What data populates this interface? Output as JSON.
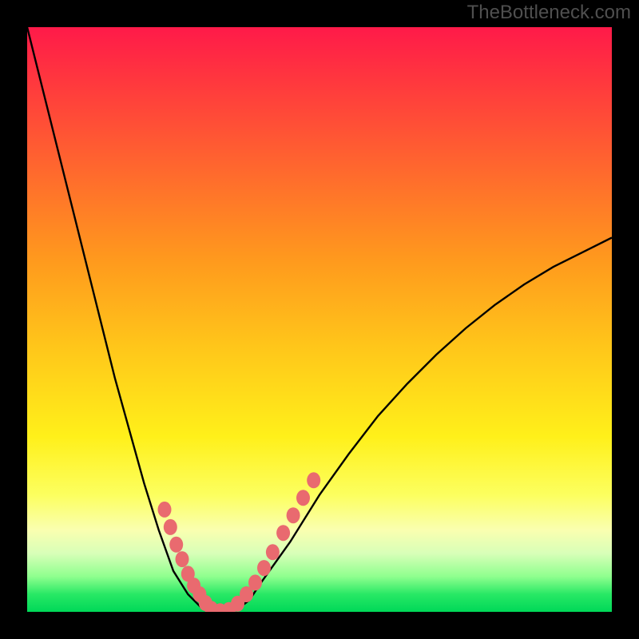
{
  "watermark": "TheBottleneck.com",
  "colors": {
    "curve": "#000000",
    "dots": "#e96a6f",
    "frame_bg": "#000000"
  },
  "chart_data": {
    "type": "line",
    "title": "",
    "xlabel": "",
    "ylabel": "",
    "xlim": [
      0,
      1
    ],
    "ylim": [
      0,
      1
    ],
    "grid": false,
    "legend": false,
    "x": [
      0.0,
      0.05,
      0.1,
      0.15,
      0.2,
      0.225,
      0.25,
      0.275,
      0.3,
      0.32,
      0.34,
      0.36,
      0.38,
      0.4,
      0.45,
      0.5,
      0.55,
      0.6,
      0.65,
      0.7,
      0.75,
      0.8,
      0.85,
      0.9,
      0.95,
      1.0
    ],
    "values": [
      1.0,
      0.8,
      0.6,
      0.4,
      0.22,
      0.14,
      0.07,
      0.03,
      0.005,
      0.0,
      0.0,
      0.005,
      0.02,
      0.05,
      0.12,
      0.2,
      0.27,
      0.335,
      0.39,
      0.44,
      0.485,
      0.525,
      0.56,
      0.59,
      0.615,
      0.64
    ],
    "minimum_x": 0.33,
    "dots_left": [
      {
        "x": 0.235,
        "y": 0.175
      },
      {
        "x": 0.245,
        "y": 0.145
      },
      {
        "x": 0.255,
        "y": 0.115
      },
      {
        "x": 0.265,
        "y": 0.09
      },
      {
        "x": 0.275,
        "y": 0.065
      },
      {
        "x": 0.285,
        "y": 0.045
      },
      {
        "x": 0.295,
        "y": 0.03
      },
      {
        "x": 0.305,
        "y": 0.015
      }
    ],
    "dots_bottom": [
      {
        "x": 0.315,
        "y": 0.005
      },
      {
        "x": 0.33,
        "y": 0.001
      },
      {
        "x": 0.345,
        "y": 0.003
      }
    ],
    "dots_right": [
      {
        "x": 0.36,
        "y": 0.014
      },
      {
        "x": 0.375,
        "y": 0.03
      },
      {
        "x": 0.39,
        "y": 0.05
      },
      {
        "x": 0.405,
        "y": 0.075
      },
      {
        "x": 0.42,
        "y": 0.102
      },
      {
        "x": 0.438,
        "y": 0.135
      },
      {
        "x": 0.455,
        "y": 0.165
      },
      {
        "x": 0.472,
        "y": 0.195
      },
      {
        "x": 0.49,
        "y": 0.225
      }
    ]
  }
}
